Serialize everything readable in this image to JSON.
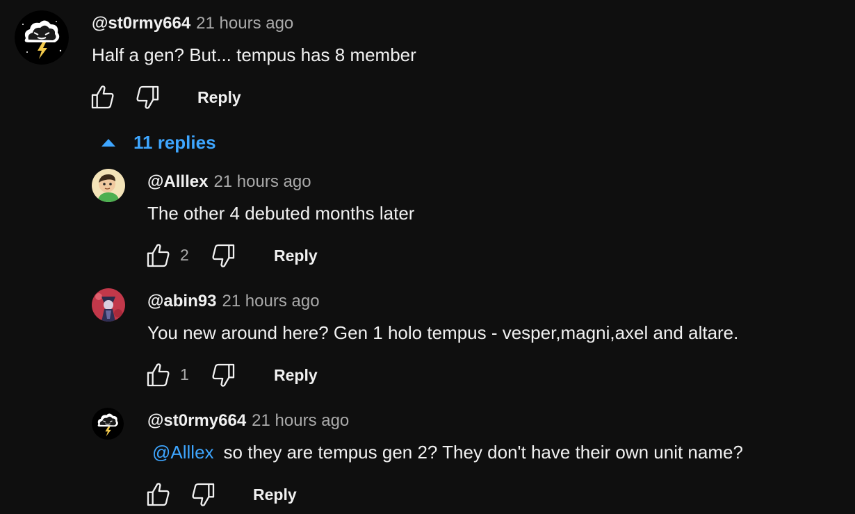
{
  "top_comment": {
    "handle": "@st0rmy664",
    "time": "21 hours ago",
    "text": "Half a gen? But... tempus has 8 member",
    "reply_label": "Reply"
  },
  "replies_toggle": {
    "label": "11 replies"
  },
  "replies": [
    {
      "handle": "@Alllex",
      "time": "21 hours ago",
      "text": "The other 4 debuted months later",
      "likes": "2",
      "reply_label": "Reply"
    },
    {
      "handle": "@abin93",
      "time": "21 hours ago",
      "text": "You new around here? Gen 1 holo tempus - vesper,magni,axel and altare.",
      "likes": "1",
      "reply_label": "Reply"
    },
    {
      "handle": "@st0rmy664",
      "time": "21 hours ago",
      "mention": "@Alllex",
      "text": "so they are tempus gen 2? They don't have their own unit name?",
      "reply_label": "Reply"
    }
  ],
  "colors": {
    "background": "#0f0f0f",
    "link": "#3ea6ff",
    "secondary_text": "#aaaaaa"
  }
}
